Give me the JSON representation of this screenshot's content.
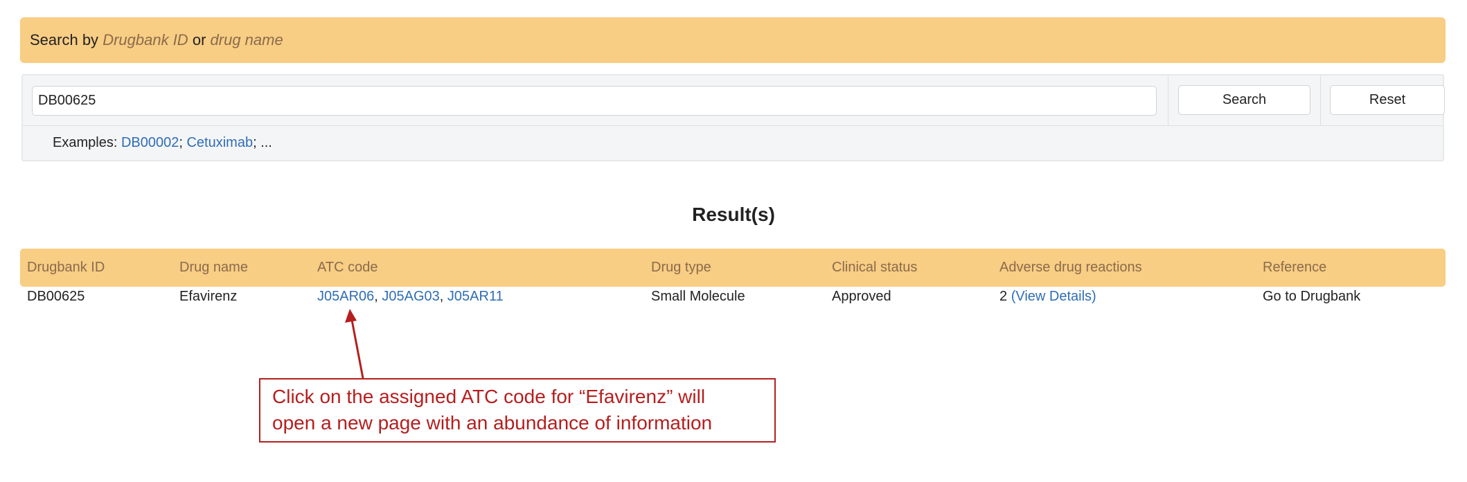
{
  "search": {
    "header": {
      "prefix": "Search by",
      "term_id": "Drugbank ID",
      "conjunction": "or",
      "term_name": "drug name"
    },
    "input_value": "DB00625",
    "search_button": "Search",
    "reset_button": "Reset",
    "examples": {
      "label": "Examples:",
      "items": [
        "DB00002",
        "Cetuximab"
      ],
      "separator": ";",
      "ellipsis": "; ..."
    }
  },
  "results": {
    "title": "Result(s)",
    "columns": [
      "Drugbank ID",
      "Drug name",
      "ATC code",
      "Drug type",
      "Clinical status",
      "Adverse drug reactions",
      "Reference"
    ],
    "rows": [
      {
        "drugbank_id": "DB00625",
        "drug_name": "Efavirenz",
        "atc_codes": [
          "J05AR06",
          "J05AG03",
          "J05AR11"
        ],
        "atc_separator": ",",
        "drug_type": "Small Molecule",
        "clinical_status": "Approved",
        "adr_count": "2",
        "adr_link": "(View Details)",
        "reference": "Go to Drugbank"
      }
    ]
  },
  "annotation": {
    "line1": "Click on the assigned ATC code for “Efavirenz” will",
    "line2": "open a new page with an abundance of information",
    "color": "#b51e1e"
  },
  "colors": {
    "header_bg": "#f8cd84",
    "header_text": "#8a6b4b",
    "link": "#2f6db5",
    "panel_bg": "#f4f5f6"
  }
}
